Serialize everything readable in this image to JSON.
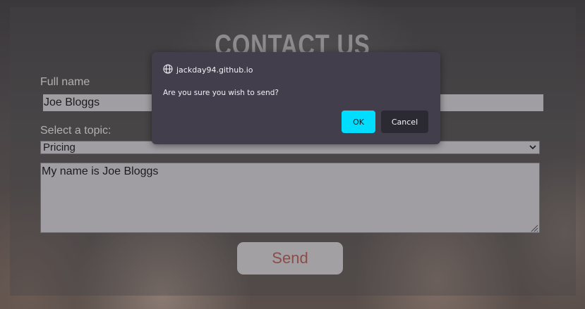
{
  "page": {
    "title": "CONTACT US",
    "form": {
      "full_name_label": "Full name",
      "full_name_value": "Joe Bloggs",
      "topic_label": "Select a topic:",
      "topic_value": "Pricing",
      "message_value": "My name is Joe Bloggs",
      "send_label": "Send"
    }
  },
  "dialog": {
    "origin": "jackday94.github.io",
    "origin_icon": "globe-icon",
    "message": "Are you sure you wish to send?",
    "ok_label": "OK",
    "cancel_label": "Cancel",
    "ok_color": "#00ddff"
  }
}
